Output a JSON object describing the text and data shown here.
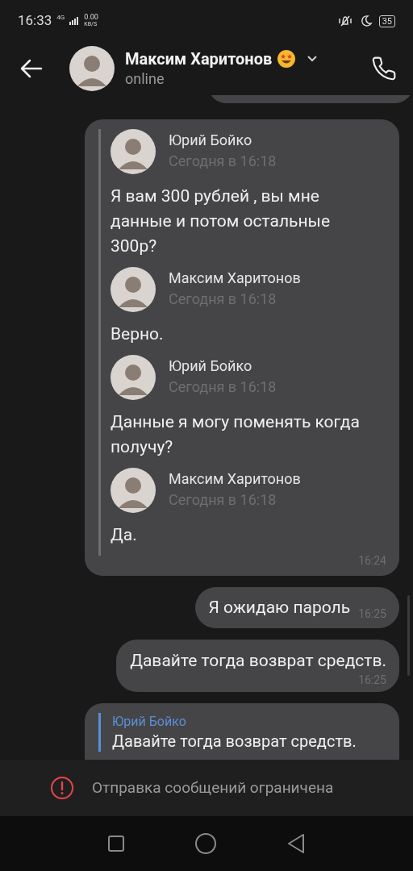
{
  "status_bar": {
    "time": "16:33",
    "network": "4G",
    "speed": "0.00",
    "speed_unit": "KB/S",
    "battery": "35"
  },
  "header": {
    "name": "Максим Харитонов",
    "status": "online"
  },
  "messages": [
    {
      "kind": "cut"
    },
    {
      "kind": "forward",
      "time": "16:24",
      "items": [
        {
          "author": "Юрий Бойко",
          "date": "Сегодня в 16:18",
          "text": "Я вам 300 рублей , вы мне данные и потом остальные 300р?"
        },
        {
          "author": "Максим Харитонов",
          "date": "Сегодня в 16:18",
          "text": "Верно."
        },
        {
          "author": "Юрий Бойко",
          "date": "Сегодня в 16:18",
          "text": "Данные я могу поменять когда получу?"
        },
        {
          "author": "Максим Харитонов",
          "date": "Сегодня в 16:18",
          "text": "Да."
        }
      ]
    },
    {
      "kind": "inline",
      "text": "Я ожидаю пароль",
      "time": "16:25"
    },
    {
      "kind": "block",
      "text": "Давайте тогда возврат средств.",
      "time": "16:25"
    },
    {
      "kind": "reply",
      "reply_author": "Юрий Бойко",
      "reply_text": "Давайте тогда возврат средств."
    }
  ],
  "restriction": {
    "text": "Отправка сообщений ограничена"
  }
}
